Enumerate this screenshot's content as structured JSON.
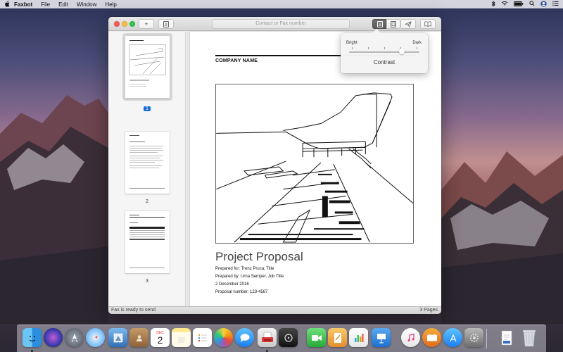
{
  "menubar": {
    "app_name": "Faxbot",
    "items": [
      "File",
      "Edit",
      "Window",
      "Help"
    ]
  },
  "toolbar": {
    "add_label": "+",
    "address_placeholder": "Contact or Fax number"
  },
  "sidebar": {
    "pages": [
      {
        "number": "1",
        "selected": true
      },
      {
        "number": "2",
        "selected": false
      },
      {
        "number": "3",
        "selected": false
      }
    ]
  },
  "document": {
    "company_name": "COMPANY NAME",
    "title": "Project Proposal",
    "lines": [
      "Prepared for: Trenz Pruca, Title",
      "Prepared by: Urna Semper, Job Title",
      "2 December 2016",
      "Proposal number: 123-4567"
    ]
  },
  "contrast_popover": {
    "bright_label": "Bright",
    "dark_label": "Dark",
    "title": "Contrast",
    "value_fraction": 0.75
  },
  "statusbar": {
    "status": "Fax is ready to send",
    "page_count": "3 Pages"
  },
  "dock": {
    "calendar_month": "DEC",
    "calendar_day": "2"
  },
  "colors": {
    "selection_blue": "#1a6dd7",
    "close": "#fc605b",
    "minimize": "#fdbc40",
    "maximize": "#34c84a"
  }
}
